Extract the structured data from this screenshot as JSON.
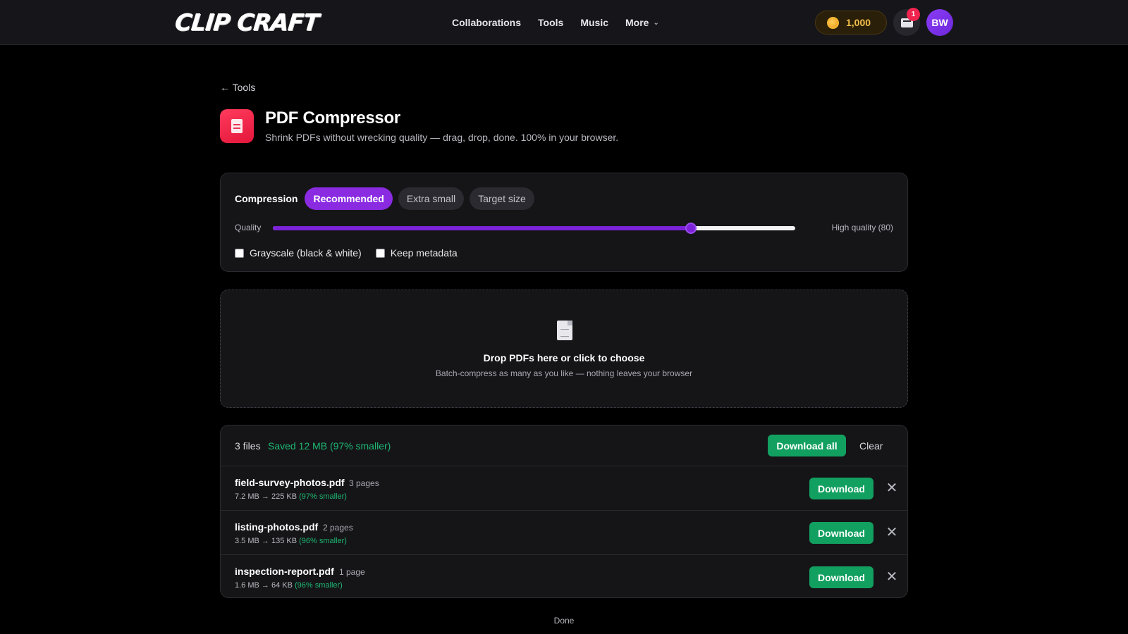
{
  "navbar": {
    "logo": "CLIP CRAFT",
    "links": [
      "Collaborations",
      "Tools",
      "Music",
      "More"
    ],
    "coins": "1,000",
    "message_badge": "1",
    "avatar_initials": "BW"
  },
  "header": {
    "back_label": "← Tools",
    "title": "PDF Compressor",
    "subtitle": "Shrink PDFs without wrecking quality — drag, drop, done. 100% in your browser."
  },
  "settings": {
    "compression_label": "Compression",
    "modes": [
      {
        "label": "Recommended",
        "active": true
      },
      {
        "label": "Extra small",
        "active": false
      },
      {
        "label": "Target size",
        "active": false
      }
    ],
    "quality_label": "Quality",
    "quality_value": 80,
    "quality_text": "High quality (80)",
    "options": [
      {
        "label": "Grayscale (black & white)",
        "checked": false
      },
      {
        "label": "Keep metadata",
        "checked": false
      }
    ]
  },
  "dropzone": {
    "title": "Drop PDFs here or click to choose",
    "subtitle": "Batch-compress as many as you like — nothing leaves your browser"
  },
  "results": {
    "file_count": "3 files",
    "saved": "Saved 12 MB (97% smaller)",
    "download_all": "Download all",
    "clear": "Clear",
    "files": [
      {
        "name": "field-survey-photos.pdf",
        "pages": "3 pages",
        "sizes": "7.2 MB → 225 KB",
        "pct": "(97% smaller)",
        "download": "Download"
      },
      {
        "name": "listing-photos.pdf",
        "pages": "2 pages",
        "sizes": "3.5 MB → 135 KB",
        "pct": "(96% smaller)",
        "download": "Download"
      },
      {
        "name": "inspection-report.pdf",
        "pages": "1 page",
        "sizes": "1.6 MB → 64 KB",
        "pct": "(96% smaller)",
        "download": "Download"
      }
    ]
  },
  "status": "Done",
  "colors": {
    "accent": "#8a2be2",
    "success": "#12a060",
    "saved_text": "#1db872",
    "badge": "#f0244e",
    "coin": "#f4c04a"
  },
  "icons": {
    "back": "arrow-left-icon",
    "tool": "pdf-document-icon",
    "dropzone": "file-icon",
    "coin": "coin-icon",
    "messages": "envelope-icon",
    "remove": "close-icon",
    "more": "chevron-down-icon"
  }
}
